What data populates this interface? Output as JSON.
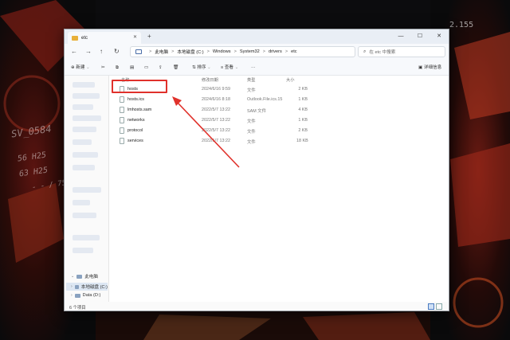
{
  "wallpaper": {
    "hud": [
      "SV_0584",
      "56 H25",
      "63 H25",
      "- - / 75",
      "2.155"
    ]
  },
  "window": {
    "tab_title": "etc",
    "tab_close": "✕",
    "new_tab": "+",
    "controls": {
      "minimize": "—",
      "maximize": "☐",
      "close": "✕"
    }
  },
  "address": {
    "back": "←",
    "forward": "→",
    "up": "↑",
    "refresh": "↻",
    "breadcrumbs": [
      "此电脑",
      "本地磁盘 (C:)",
      "Windows",
      "System32",
      "drivers",
      "etc"
    ],
    "separator": ">",
    "search_placeholder": "在 etc 中搜索"
  },
  "toolbar": {
    "new_label": "新建",
    "sort_label": "排序",
    "view_label": "查看",
    "more_label": "···",
    "details_label": "详细信息"
  },
  "sidebar": {
    "tree": [
      {
        "label": "此电脑",
        "selected": false
      },
      {
        "label": "本地磁盘 (C:)",
        "selected": true
      },
      {
        "label": "Data (D:)",
        "selected": false
      }
    ]
  },
  "columns": {
    "name": "名称",
    "date": "修改日期",
    "type": "类型",
    "size": "大小"
  },
  "files": [
    {
      "name": "hosts",
      "date": "2024/6/16 9:59",
      "type": "文件",
      "size": "2 KB"
    },
    {
      "name": "hosts.ics",
      "date": "2024/6/16 8:18",
      "type": "Outlook.File.ics.15",
      "size": "1 KB"
    },
    {
      "name": "lmhosts.sam",
      "date": "2022/5/7 13:22",
      "type": "SAM 文件",
      "size": "4 KB"
    },
    {
      "name": "networks",
      "date": "2022/5/7 13:22",
      "type": "文件",
      "size": "1 KB"
    },
    {
      "name": "protocol",
      "date": "2022/5/7 13:22",
      "type": "文件",
      "size": "2 KB"
    },
    {
      "name": "services",
      "date": "2022/5/7 13:22",
      "type": "文件",
      "size": "18 KB"
    }
  ],
  "status": {
    "item_count": "6 个项目"
  },
  "colors": {
    "highlight": "#e0312b",
    "arrow": "#e0312b",
    "folder": "#e8b03a"
  }
}
